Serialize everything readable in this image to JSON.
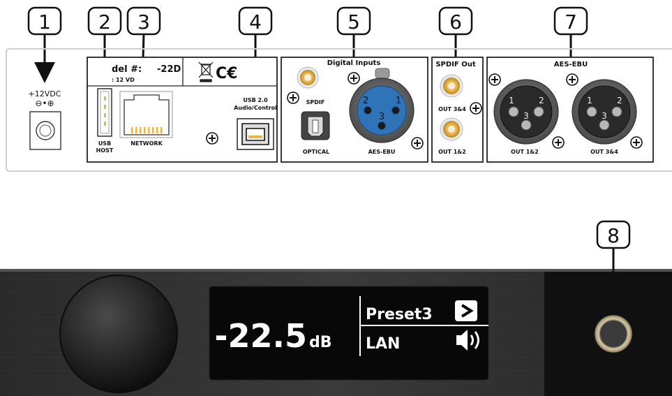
{
  "callouts": [
    "1",
    "2",
    "3",
    "4",
    "5",
    "6",
    "7",
    "8"
  ],
  "rear_panel": {
    "power": {
      "label": "+12VDC",
      "polarity": "⊖•⊕"
    },
    "model_label": {
      "line1": "del #:",
      "line1_suffix": "-22D",
      "line2": ": 12 VD"
    },
    "usb_host": {
      "line1": "USB",
      "line2": "HOST"
    },
    "network": "NETWORK",
    "usb20": {
      "line1": "USB 2.0",
      "line2": "Audio/Control"
    },
    "digital_inputs": {
      "title": "Digital Inputs",
      "spdif": "SPDIF",
      "optical": "OPTICAL",
      "aesebu": "AES-EBU",
      "xlr_pins": [
        "2",
        "1",
        "3"
      ]
    },
    "spdif_out": {
      "title": "SPDIF Out",
      "out34": "OUT 3&4",
      "out12": "OUT 1&2"
    },
    "aes_ebu": {
      "title": "AES-EBU",
      "out12": "OUT 1&2",
      "out34": "OUT 3&4",
      "xlr_pins": [
        "1",
        "2",
        "3"
      ]
    }
  },
  "display": {
    "volume_value": "-22.5",
    "volume_unit": "dB",
    "preset": "Preset3",
    "source": "LAN"
  },
  "colors": {
    "callout_stroke": "#111111",
    "panel_border": "#222222",
    "rca_gold": "#e9b94a",
    "xlr_blue": "#2f73b8",
    "display_text": "#ffffff",
    "front_bg": "#1a1a1a"
  },
  "icons": {
    "input_icon": "input-arrow-icon",
    "speaker_icon": "speaker-volume-icon",
    "screw_icon": "screw-plus-icon"
  }
}
